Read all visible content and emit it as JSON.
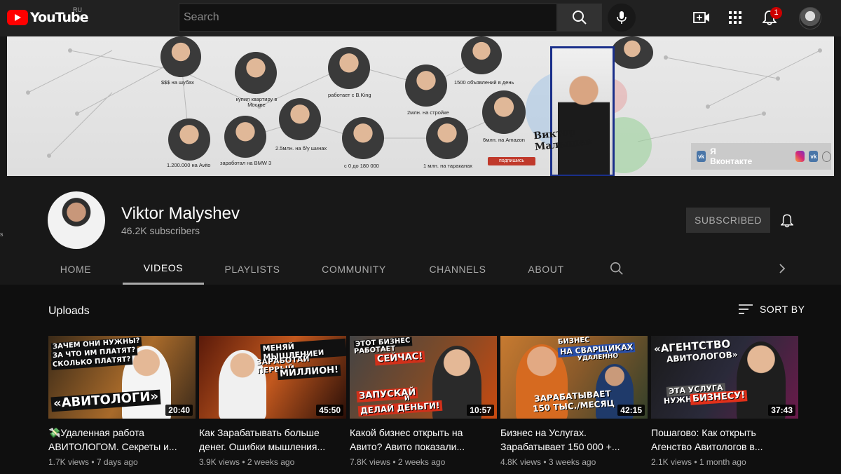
{
  "topbar": {
    "logo_text": "YouTube",
    "region": "RU",
    "search_placeholder": "Search",
    "notification_count": "1"
  },
  "banner": {
    "captions": [
      "$$$ на шубах",
      "купил квартиру в Москве",
      "работает с B.King",
      "1500 объявлений в день",
      "2млн. на стройке",
      "6млн. на Amazon",
      "2.5млн. на б/у шинах",
      "1.200.000 на Avito",
      "заработал на BMW 3",
      "с 0 до 180 000",
      "1 млн. на тараканах"
    ],
    "name_line1": "Виктор",
    "name_line2": "Малышев",
    "subscribe_label": "подпишись",
    "link_label": "Я Вконтакте"
  },
  "channel": {
    "name": "Viktor Malyshev",
    "subscribers": "46.2K subscribers",
    "subscribed_label": "SUBSCRIBED"
  },
  "tabs": [
    "HOME",
    "VIDEOS",
    "PLAYLISTS",
    "COMMUNITY",
    "CHANNELS",
    "ABOUT"
  ],
  "uploads": {
    "title": "Uploads",
    "sort_label": "SORT BY"
  },
  "videos": [
    {
      "thumb_text": [
        "ЗАЧЕМ ОНИ НУЖНЫ?",
        "ЗА ЧТО ИМ ПЛАТЯТ?",
        "СКОЛЬКО ПЛАТЯТ?",
        "«АВИТОЛОГИ»"
      ],
      "duration": "20:40",
      "title": "💸Удаленная работа АВИТОЛОГОМ. Секреты и...",
      "views": "1.7K views",
      "age": "7 days ago"
    },
    {
      "thumb_text": [
        "МЕНЯЙ МЫШЛЕНИЕ",
        "И",
        "ЗАРАБОТАЙ ПЕРВЫЙ",
        "МИЛЛИОН!"
      ],
      "duration": "45:50",
      "title": "Как Зарабатывать больше денег. Ошибки мышления...",
      "views": "3.9K views",
      "age": "2 weeks ago"
    },
    {
      "thumb_text": [
        "ЭТОТ БИЗНЕС",
        "РАБОТАЕТ",
        "СЕЙЧАС!",
        "ЗАПУСКАЙ",
        "И",
        "ДЕЛАЙ ДЕНЬГИ!"
      ],
      "duration": "10:57",
      "title": "Какой бизнес открыть на Авито? Авито показали...",
      "views": "7.8K views",
      "age": "2 weeks ago"
    },
    {
      "thumb_text": [
        "БИЗНЕС",
        "НА СВАРЩИКАХ",
        "УДАЛЕННО",
        "ЗАРАБАТЫВАЕТ",
        "150 ТЫС./МЕСЯЦ"
      ],
      "duration": "42:15",
      "title": "Бизнес на Услугах. Зарабатывает 150 000 +...",
      "views": "4.8K views",
      "age": "3 weeks ago"
    },
    {
      "thumb_text": [
        "«АГЕНТСТВО",
        "АВИТОЛОГОВ»",
        "ЭТА УСЛУГА",
        "НУЖНА",
        "БИЗНЕСУ!"
      ],
      "duration": "37:43",
      "title": "Пошагово: Как открыть Агенство Авитологов в...",
      "views": "2.1K views",
      "age": "1 month ago"
    }
  ],
  "colors": {
    "brand_red": "#ff0000",
    "banner_frame": "#1a2f8a",
    "text_secondary": "#aaaaaa"
  }
}
